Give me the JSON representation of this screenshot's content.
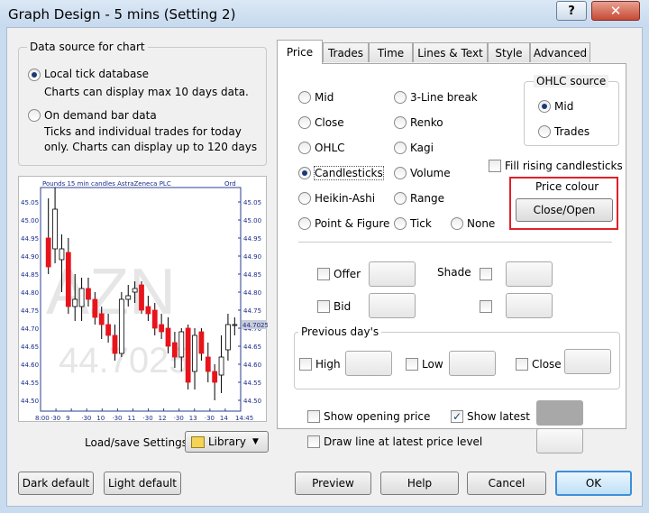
{
  "window": {
    "title": "Graph Design - 5 mins (Setting 2)",
    "help_glyph": "?",
    "close_glyph": "✕"
  },
  "datasource": {
    "legend": "Data source for chart",
    "local_label": "Local tick database",
    "local_desc": "Charts can display max 10 days data.",
    "demand_label": "On demand bar data",
    "demand_desc1": "Ticks and individual trades for today",
    "demand_desc2": "only. Charts can display up to 120 days",
    "selected": "local"
  },
  "preview": {
    "header": "Pounds 15 min candles AstraZeneca PLC",
    "header_right": "Ord",
    "watermark_symbol": "AZN",
    "watermark_price": "44.7025",
    "price_badge": "44.7025",
    "y_ticks": [
      "45.05",
      "45.00",
      "44.95",
      "44.90",
      "44.85",
      "44.80",
      "44.75",
      "44.70",
      "44.65",
      "44.60",
      "44.55",
      "44.50"
    ],
    "x_ticks": [
      "8:00",
      "·30",
      "9",
      "·30",
      "10",
      "·30",
      "11",
      "·30",
      "12",
      "·30",
      "13",
      "·30",
      "14",
      "14:45"
    ]
  },
  "chart_data": {
    "type": "candlestick",
    "ylim": [
      44.47,
      45.09
    ],
    "candles": [
      {
        "o": 44.95,
        "h": 45.06,
        "l": 44.85,
        "c": 44.87,
        "color": "red"
      },
      {
        "o": 44.92,
        "h": 45.09,
        "l": 44.88,
        "c": 45.03,
        "color": "white"
      },
      {
        "o": 44.89,
        "h": 44.96,
        "l": 44.8,
        "c": 44.92,
        "color": "white"
      },
      {
        "o": 44.91,
        "h": 44.95,
        "l": 44.74,
        "c": 44.76,
        "color": "red"
      },
      {
        "o": 44.76,
        "h": 44.85,
        "l": 44.72,
        "c": 44.78,
        "color": "white"
      },
      {
        "o": 44.81,
        "h": 44.84,
        "l": 44.72,
        "c": 44.76,
        "color": "white"
      },
      {
        "o": 44.81,
        "h": 44.84,
        "l": 44.76,
        "c": 44.78,
        "color": "red"
      },
      {
        "o": 44.78,
        "h": 44.8,
        "l": 44.71,
        "c": 44.73,
        "color": "red"
      },
      {
        "o": 44.74,
        "h": 44.76,
        "l": 44.67,
        "c": 44.71,
        "color": "red"
      },
      {
        "o": 44.71,
        "h": 44.74,
        "l": 44.66,
        "c": 44.68,
        "color": "red"
      },
      {
        "o": 44.68,
        "h": 44.71,
        "l": 44.61,
        "c": 44.63,
        "color": "red"
      },
      {
        "o": 44.63,
        "h": 44.8,
        "l": 44.62,
        "c": 44.78,
        "color": "white"
      },
      {
        "o": 44.78,
        "h": 44.82,
        "l": 44.76,
        "c": 44.79,
        "color": "white"
      },
      {
        "o": 44.8,
        "h": 44.83,
        "l": 44.77,
        "c": 44.81,
        "color": "white"
      },
      {
        "o": 44.82,
        "h": 44.83,
        "l": 44.74,
        "c": 44.75,
        "color": "red"
      },
      {
        "o": 44.76,
        "h": 44.79,
        "l": 44.72,
        "c": 44.74,
        "color": "red"
      },
      {
        "o": 44.75,
        "h": 44.77,
        "l": 44.68,
        "c": 44.7,
        "color": "red"
      },
      {
        "o": 44.71,
        "h": 44.74,
        "l": 44.67,
        "c": 44.69,
        "color": "red"
      },
      {
        "o": 44.7,
        "h": 44.73,
        "l": 44.63,
        "c": 44.65,
        "color": "red"
      },
      {
        "o": 44.66,
        "h": 44.69,
        "l": 44.59,
        "c": 44.62,
        "color": "red"
      },
      {
        "o": 44.62,
        "h": 44.7,
        "l": 44.58,
        "c": 44.69,
        "color": "white"
      },
      {
        "o": 44.7,
        "h": 44.71,
        "l": 44.53,
        "c": 44.55,
        "color": "red"
      },
      {
        "o": 44.58,
        "h": 44.7,
        "l": 44.53,
        "c": 44.68,
        "color": "white"
      },
      {
        "o": 44.69,
        "h": 44.7,
        "l": 44.61,
        "c": 44.63,
        "color": "red"
      },
      {
        "o": 44.62,
        "h": 44.66,
        "l": 44.55,
        "c": 44.58,
        "color": "red"
      },
      {
        "o": 44.58,
        "h": 44.6,
        "l": 44.5,
        "c": 44.55,
        "color": "red"
      },
      {
        "o": 44.57,
        "h": 44.68,
        "l": 44.52,
        "c": 44.62,
        "color": "white"
      },
      {
        "o": 44.64,
        "h": 44.74,
        "l": 44.61,
        "c": 44.71,
        "color": "white"
      },
      {
        "o": 44.71,
        "h": 44.73,
        "l": 44.68,
        "c": 44.71,
        "color": "white"
      }
    ]
  },
  "library": {
    "label": "Load/save Settings",
    "button": "Library"
  },
  "tabs": [
    {
      "label": "Price",
      "active": true
    },
    {
      "label": "Trades"
    },
    {
      "label": "Time"
    },
    {
      "label": "Lines & Text"
    },
    {
      "label": "Style"
    },
    {
      "label": "Advanced"
    }
  ],
  "price": {
    "styles_col1": [
      "Mid",
      "Close",
      "OHLC",
      "Candlesticks",
      "Heikin-Ashi",
      "Point & Figure"
    ],
    "styles_col2": [
      "3-Line break",
      "Renko",
      "Kagi",
      "Volume",
      "Range",
      "Tick"
    ],
    "none_label": "None",
    "selected": "Candlesticks",
    "ohlc": {
      "legend": "OHLC source",
      "mid": "Mid",
      "trades": "Trades",
      "selected": "Mid"
    },
    "fill_rising": "Fill rising candlesticks",
    "price_colour": {
      "label": "Price colour",
      "button": "Close/Open",
      "highlight": "#e0202a"
    },
    "offer": "Offer",
    "bid": "Bid",
    "shade": "Shade",
    "prev": {
      "legend": "Previous day's",
      "high": "High",
      "low": "Low",
      "close": "Close"
    },
    "show_opening": "Show opening price",
    "show_latest": "Show latest",
    "show_latest_checked": true,
    "show_latest_color": "#a8a8a8",
    "draw_line": "Draw line at latest price level"
  },
  "buttons": {
    "dark": "Dark default",
    "light": "Light default",
    "preview": "Preview",
    "help": "Help",
    "cancel": "Cancel",
    "ok": "OK"
  }
}
